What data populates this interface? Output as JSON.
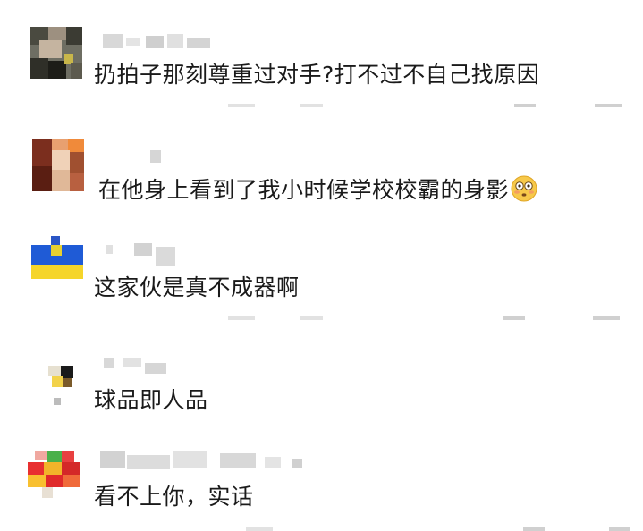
{
  "comments": [
    {
      "text": "扔拍子那刻尊重过对手?打不过不自己找原因",
      "has_emoji": false
    },
    {
      "text": "在他身上看到了我小时候学校校霸的身影",
      "has_emoji": true,
      "emoji": "flushed-face"
    },
    {
      "text": "这家伙是真不成器啊",
      "has_emoji": false
    },
    {
      "text": "球品即人品",
      "has_emoji": false
    },
    {
      "text": "看不上你，实话",
      "has_emoji": false
    }
  ],
  "colors": {
    "background": "#ffffff",
    "text": "#1a1a1a",
    "blur_gray": "#d8d8d8"
  }
}
